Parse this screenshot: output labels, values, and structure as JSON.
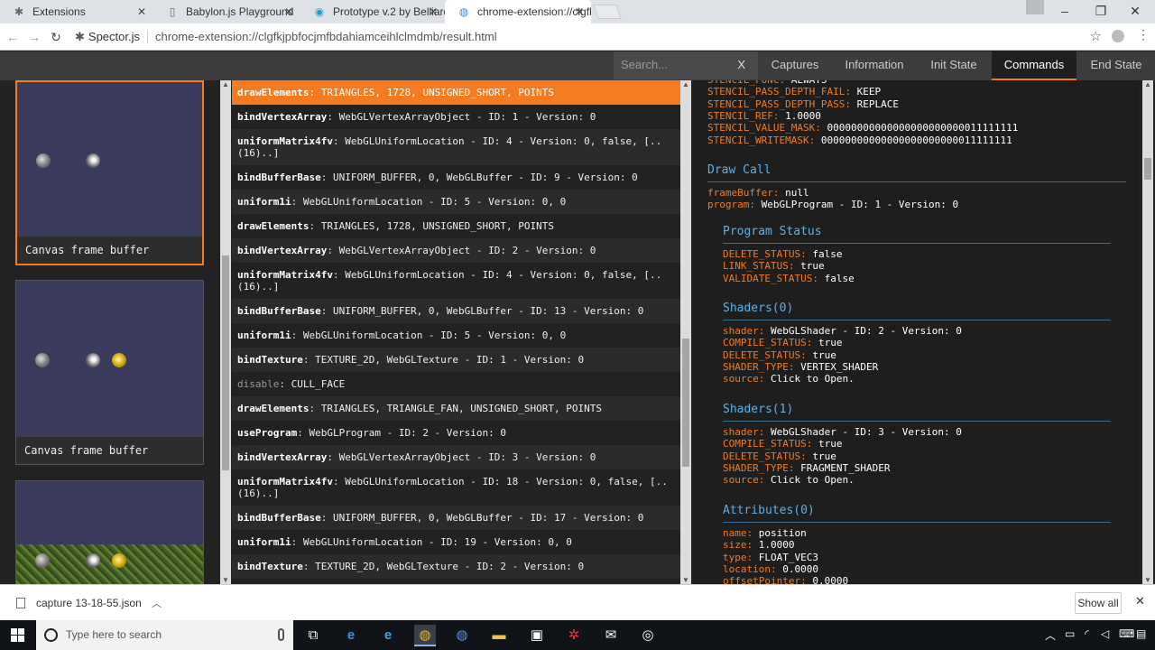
{
  "browser": {
    "tabs": [
      {
        "title": "Extensions",
        "icon": "puzzle-icon"
      },
      {
        "title": "Babylon.js Playground",
        "icon": "page-icon"
      },
      {
        "title": "Prototype v.2 by Belliard",
        "icon": "codepen-icon"
      },
      {
        "title": "chrome-extension://clgfk",
        "icon": "chrome-icon"
      }
    ],
    "site_chip": "Spector.js",
    "url": "chrome-extension://clgfkjpbfocjmfbdahiamceihlclmdmb/result.html"
  },
  "spector": {
    "search_placeholder": "Search...",
    "search_clear": "X",
    "nav": [
      "Captures",
      "Information",
      "Init State",
      "Commands",
      "End State"
    ],
    "active_nav": "Commands",
    "captures": [
      {
        "caption": "Canvas frame buffer",
        "selected": true
      },
      {
        "caption": "Canvas frame buffer",
        "selected": false
      },
      {
        "caption": "",
        "selected": false
      }
    ],
    "commands": [
      {
        "name": "drawElements",
        "args": "TRIANGLES, 1728, UNSIGNED_SHORT, POINTS",
        "selected": true
      },
      {
        "name": "bindVertexArray",
        "args": "WebGLVertexArrayObject - ID: 1 - Version: 0"
      },
      {
        "name": "uniformMatrix4fv",
        "args": "WebGLUniformLocation - ID: 4 - Version: 0, false, [..",
        "args2": "(16)..]"
      },
      {
        "name": "bindBufferBase",
        "args": "UNIFORM_BUFFER, 0, WebGLBuffer - ID: 9 - Version: 0"
      },
      {
        "name": "uniform1i",
        "args": "WebGLUniformLocation - ID: 5 - Version: 0, 0"
      },
      {
        "name": "drawElements",
        "args": "TRIANGLES, 1728, UNSIGNED_SHORT, POINTS"
      },
      {
        "name": "bindVertexArray",
        "args": "WebGLVertexArrayObject - ID: 2 - Version: 0"
      },
      {
        "name": "uniformMatrix4fv",
        "args": "WebGLUniformLocation - ID: 4 - Version: 0, false, [..",
        "args2": "(16)..]"
      },
      {
        "name": "bindBufferBase",
        "args": "UNIFORM_BUFFER, 0, WebGLBuffer - ID: 13 - Version: 0"
      },
      {
        "name": "uniform1i",
        "args": "WebGLUniformLocation - ID: 5 - Version: 0, 0"
      },
      {
        "name": "bindTexture",
        "args": "TEXTURE_2D, WebGLTexture - ID: 1 - Version: 0"
      },
      {
        "name": "disable",
        "args": "CULL_FACE",
        "disabled": true
      },
      {
        "name": "drawElements",
        "args": "TRIANGLES, TRIANGLE_FAN, UNSIGNED_SHORT, POINTS"
      },
      {
        "name": "useProgram",
        "args": "WebGLProgram - ID: 2 - Version: 0"
      },
      {
        "name": "bindVertexArray",
        "args": "WebGLVertexArrayObject - ID: 3 - Version: 0"
      },
      {
        "name": "uniformMatrix4fv",
        "args": "WebGLUniformLocation - ID: 18 - Version: 0, false, [..",
        "args2": "(16)..]"
      },
      {
        "name": "bindBufferBase",
        "args": "UNIFORM_BUFFER, 0, WebGLBuffer - ID: 17 - Version: 0"
      },
      {
        "name": "uniform1i",
        "args": "WebGLUniformLocation - ID: 19 - Version: 0, 0"
      },
      {
        "name": "bindTexture",
        "args": "TEXTURE_2D, WebGLTexture - ID: 2 - Version: 0"
      }
    ],
    "detail": {
      "top_state": [
        {
          "k": "STENCIL_FUNC",
          "v": "ALWAYS"
        },
        {
          "k": "STENCIL_PASS_DEPTH_FAIL",
          "v": "KEEP"
        },
        {
          "k": "STENCIL_PASS_DEPTH_PASS",
          "v": "REPLACE"
        },
        {
          "k": "STENCIL_REF",
          "v": "1.0000"
        },
        {
          "k": "STENCIL_VALUE_MASK",
          "v": "00000000000000000000000011111111"
        },
        {
          "k": "STENCIL_WRITEMASK",
          "v": "00000000000000000000000011111111"
        }
      ],
      "draw_call_title": "Draw Call",
      "draw_call": [
        {
          "k": "frameBuffer",
          "v": "null"
        },
        {
          "k": "program",
          "v": "WebGLProgram - ID: 1 - Version: 0"
        }
      ],
      "program_status_title": "Program Status",
      "program_status": [
        {
          "k": "DELETE_STATUS",
          "v": "false"
        },
        {
          "k": "LINK_STATUS",
          "v": "true"
        },
        {
          "k": "VALIDATE_STATUS",
          "v": "false"
        }
      ],
      "shader0_title": "Shaders(0)",
      "shader0": [
        {
          "k": "shader",
          "v": "WebGLShader - ID: 2 - Version: 0"
        },
        {
          "k": "COMPILE_STATUS",
          "v": "true"
        },
        {
          "k": "DELETE_STATUS",
          "v": "true"
        },
        {
          "k": "SHADER_TYPE",
          "v": "VERTEX_SHADER"
        },
        {
          "k": "source",
          "v": "Click to Open."
        }
      ],
      "shader1_title": "Shaders(1)",
      "shader1": [
        {
          "k": "shader",
          "v": "WebGLShader - ID: 3 - Version: 0"
        },
        {
          "k": "COMPILE_STATUS",
          "v": "true"
        },
        {
          "k": "DELETE_STATUS",
          "v": "true"
        },
        {
          "k": "SHADER_TYPE",
          "v": "FRAGMENT_SHADER"
        },
        {
          "k": "source",
          "v": "Click to Open."
        }
      ],
      "attributes_title": "Attributes(0)",
      "attributes": [
        {
          "k": "name",
          "v": "position"
        },
        {
          "k": "size",
          "v": "1.0000"
        },
        {
          "k": "type",
          "v": "FLOAT_VEC3"
        },
        {
          "k": "location",
          "v": "0.0000"
        },
        {
          "k": "offsetPointer",
          "v": "0.0000"
        }
      ]
    }
  },
  "downloads": {
    "file": "capture 13-18-55.json",
    "show_all": "Show all"
  },
  "taskbar": {
    "search_placeholder": "Type here to search"
  }
}
